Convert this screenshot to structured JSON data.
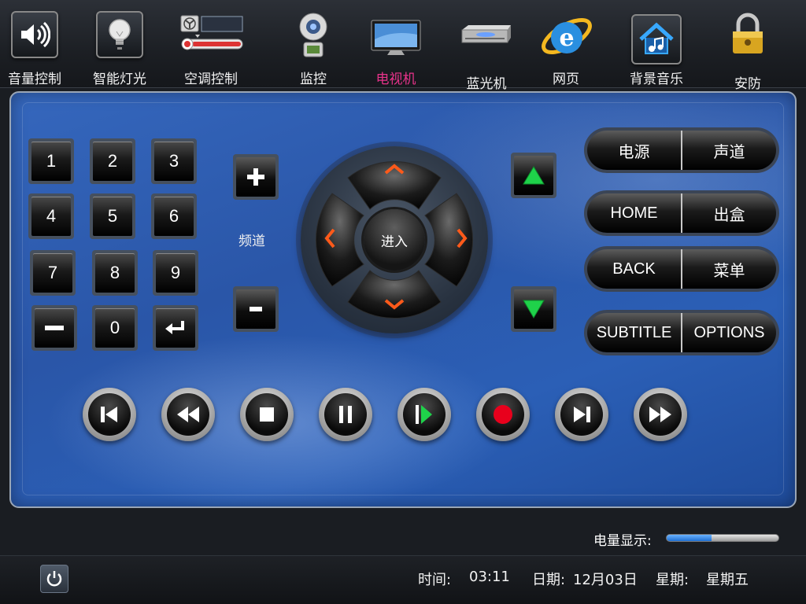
{
  "nav": {
    "items": [
      {
        "label": "音量控制",
        "icon": "speaker-icon"
      },
      {
        "label": "智能灯光",
        "icon": "lightbulb-icon"
      },
      {
        "label": "空调控制",
        "icon": "thermostat-icon"
      },
      {
        "label": "监控",
        "icon": "webcam-icon"
      },
      {
        "label": "电视机",
        "icon": "tv-icon",
        "active": true
      },
      {
        "label": "蓝光机",
        "icon": "bluray-player-icon"
      },
      {
        "label": "网页",
        "icon": "browser-icon"
      },
      {
        "label": "背景音乐",
        "icon": "home-music-icon"
      },
      {
        "label": "安防",
        "icon": "padlock-icon"
      }
    ],
    "active_color": "#e8338b"
  },
  "keypad": {
    "keys": [
      "1",
      "2",
      "3",
      "4",
      "5",
      "6",
      "7",
      "8",
      "9",
      "",
      "0",
      ""
    ]
  },
  "channel": {
    "label": "频道",
    "plus": "+",
    "minus": "-"
  },
  "dpad": {
    "center_label": "进入",
    "arrow_color": "#ff5a1a"
  },
  "pills": [
    {
      "left": "电源",
      "right": "声道"
    },
    {
      "left": "HOME",
      "right": "出盒"
    },
    {
      "left": "BACK",
      "right": "菜单"
    },
    {
      "left": "SUBTITLE",
      "right": "OPTIONS"
    }
  ],
  "transport": [
    "prev-track-icon",
    "rewind-icon",
    "stop-icon",
    "pause-icon",
    "play-icon",
    "record-icon",
    "next-track-icon",
    "fast-forward-icon"
  ],
  "battery": {
    "label": "电量显示:",
    "level": 0.4
  },
  "status": {
    "time_label": "时间:",
    "time": "03:11",
    "date_label": "日期:",
    "date": "12月03日",
    "weekday_label": "星期:",
    "weekday": "星期五"
  }
}
